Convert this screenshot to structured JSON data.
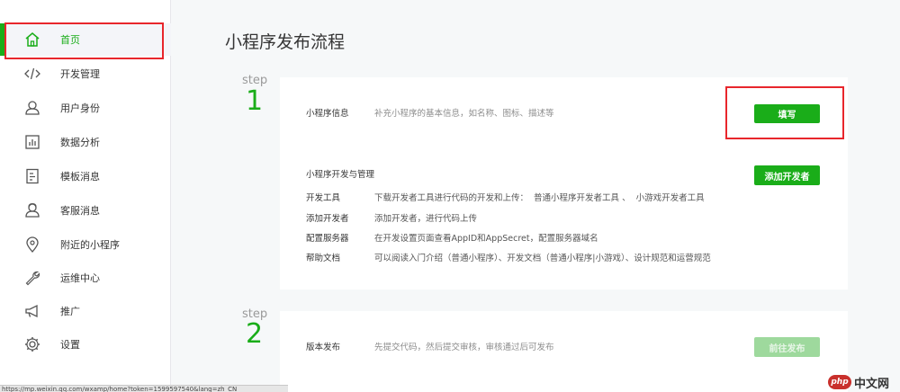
{
  "sidebar": {
    "items": [
      {
        "label": "首页",
        "icon": "home-icon",
        "active": true
      },
      {
        "label": "开发管理",
        "icon": "code-icon"
      },
      {
        "label": "用户身份",
        "icon": "user-icon"
      },
      {
        "label": "数据分析",
        "icon": "chart-icon"
      },
      {
        "label": "模板消息",
        "icon": "document-icon"
      },
      {
        "label": "客服消息",
        "icon": "support-icon"
      },
      {
        "label": "附近的小程序",
        "icon": "location-pin-icon"
      },
      {
        "label": "运维中心",
        "icon": "wrench-icon"
      },
      {
        "label": "推广",
        "icon": "megaphone-icon"
      },
      {
        "label": "设置",
        "icon": "gear-icon"
      }
    ]
  },
  "main": {
    "title": "小程序发布流程",
    "steps": [
      {
        "word": "step",
        "number": "1",
        "info_label": "小程序信息",
        "info_desc": "补充小程序的基本信息，如名称、图标、描述等",
        "fill_button": "填写",
        "dev_section_title": "小程序开发与管理",
        "add_dev_button": "添加开发者",
        "rows": [
          {
            "label": "开发工具",
            "desc": "下载开发者工具进行代码的开发和上传：",
            "links": [
              "普通小程序开发者工具",
              "小游戏开发者工具"
            ]
          },
          {
            "label": "添加开发者",
            "desc": "添加开发者，进行代码上传"
          },
          {
            "label": "配置服务器",
            "desc": "在开发设置页面查看AppID和AppSecret，配置服务器域名"
          },
          {
            "label": "帮助文档",
            "desc": "可以阅读入门介绍（普通小程序）、开发文档（普通小程序|小游戏）、设计规范和运营规范"
          }
        ]
      },
      {
        "word": "step",
        "number": "2",
        "info_label": "版本发布",
        "info_desc": "先提交代码，然后提交审核，审核通过后可发布",
        "publish_button": "前往发布"
      }
    ]
  },
  "statusbar": {
    "url": "https://mp.weixin.qq.com/wxamp/home?token=1599597540&lang=zh_CN"
  },
  "watermark": {
    "logo": "php",
    "text": "中文网"
  },
  "colors": {
    "accent": "#1aad19",
    "highlight": "#e8262c",
    "disabled": "#9ed99d"
  }
}
